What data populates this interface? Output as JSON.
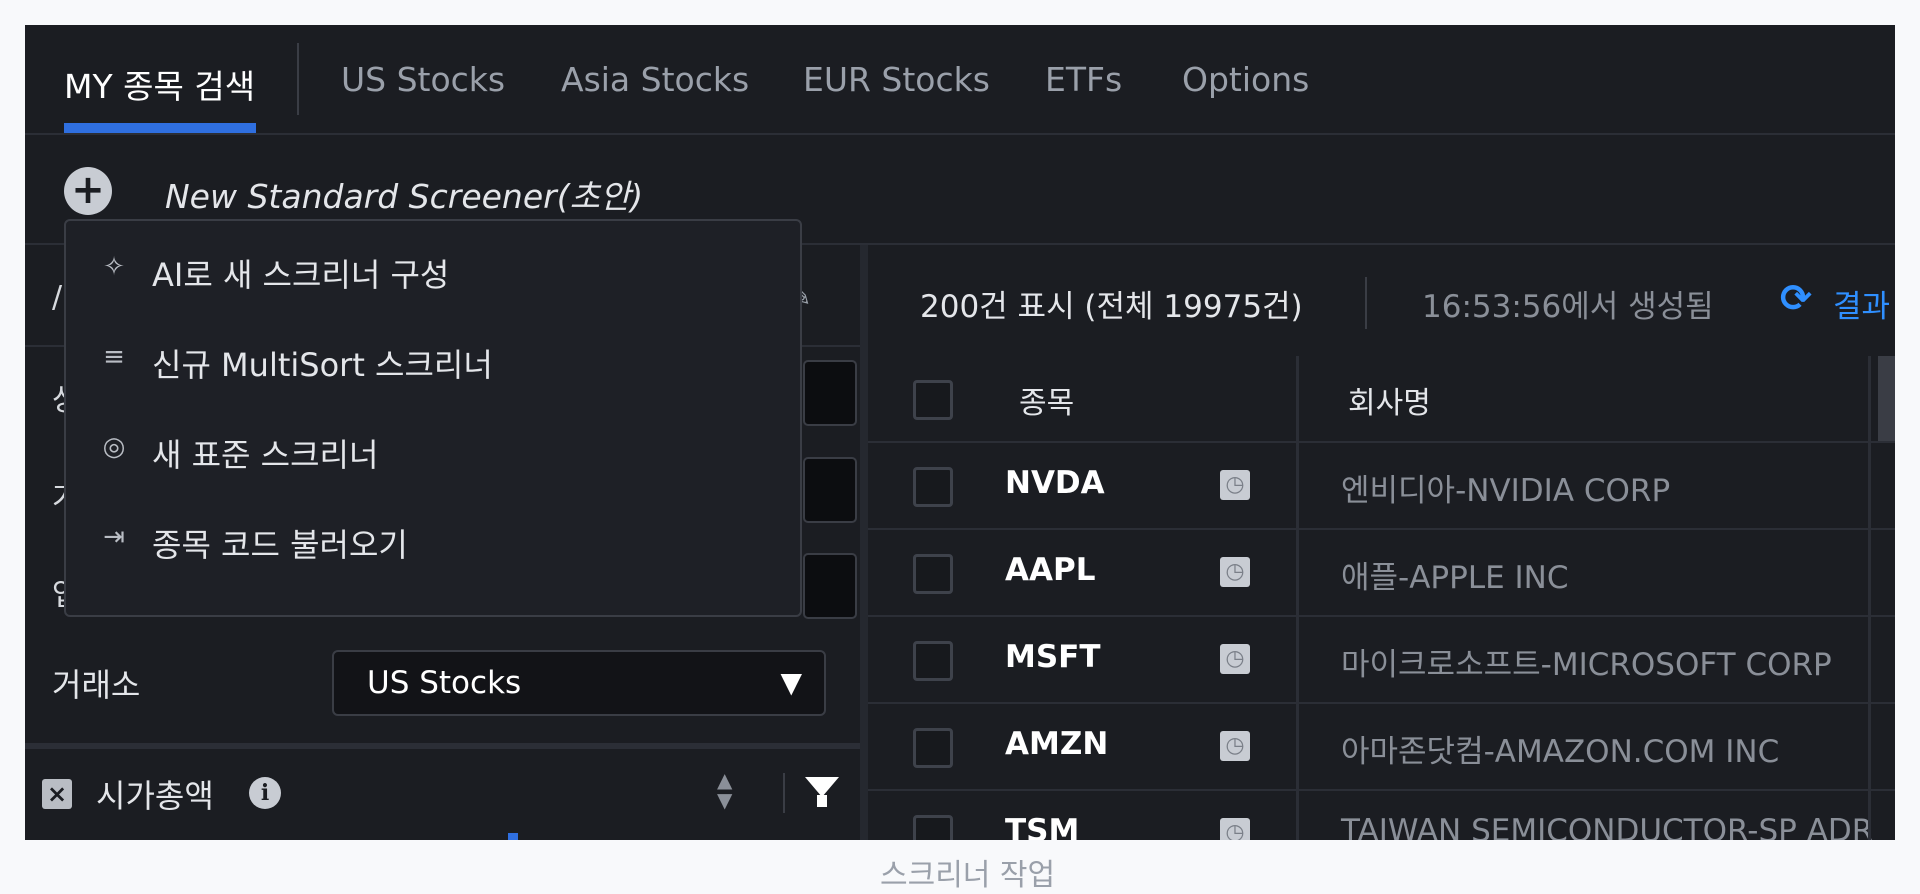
{
  "tabs": [
    {
      "label": "MY 종목 검색"
    },
    {
      "label": "US Stocks"
    },
    {
      "label": "Asia Stocks"
    },
    {
      "label": "EUR Stocks"
    },
    {
      "label": "ETFs"
    },
    {
      "label": "Options"
    }
  ],
  "screener": {
    "name": "New Standard Screener(초안)"
  },
  "menu": {
    "items": [
      {
        "label": "AI로 새 스크리너 구성",
        "icon": "sparkle-icon"
      },
      {
        "label": "신규 MultiSort 스크리너",
        "icon": "multisort-icon"
      },
      {
        "label": "새 표준 스크리너",
        "icon": "standard-icon"
      },
      {
        "label": "종목 코드 불러오기",
        "icon": "import-icon"
      }
    ]
  },
  "left": {
    "fragments": [
      "/",
      "상",
      "가",
      "업"
    ],
    "exchange_label": "거래소",
    "exchange_value": "US Stocks",
    "filter_label": "시가총액"
  },
  "results": {
    "count_text": "200건 표시 (전체 19975건)",
    "time_text": "16:53:56에서 생성됨",
    "refresh_label": "결과"
  },
  "table": {
    "headers": {
      "ticker": "종목",
      "company": "회사명"
    },
    "rows": [
      {
        "ticker": "NVDA",
        "company": "엔비디아-NVIDIA CORP"
      },
      {
        "ticker": "AAPL",
        "company": "애플-APPLE INC"
      },
      {
        "ticker": "MSFT",
        "company": "마이크로소프트-MICROSOFT CORP"
      },
      {
        "ticker": "AMZN",
        "company": "아마존닷컴-AMAZON.COM INC"
      },
      {
        "ticker": "TSM",
        "company": "TAIWAN SEMICONDUCTOR-SP ADR"
      }
    ]
  },
  "caption": "스크리너 작업",
  "colors": {
    "accent": "#2f6fe0",
    "link": "#2f8fff",
    "background": "#1b1d22"
  }
}
